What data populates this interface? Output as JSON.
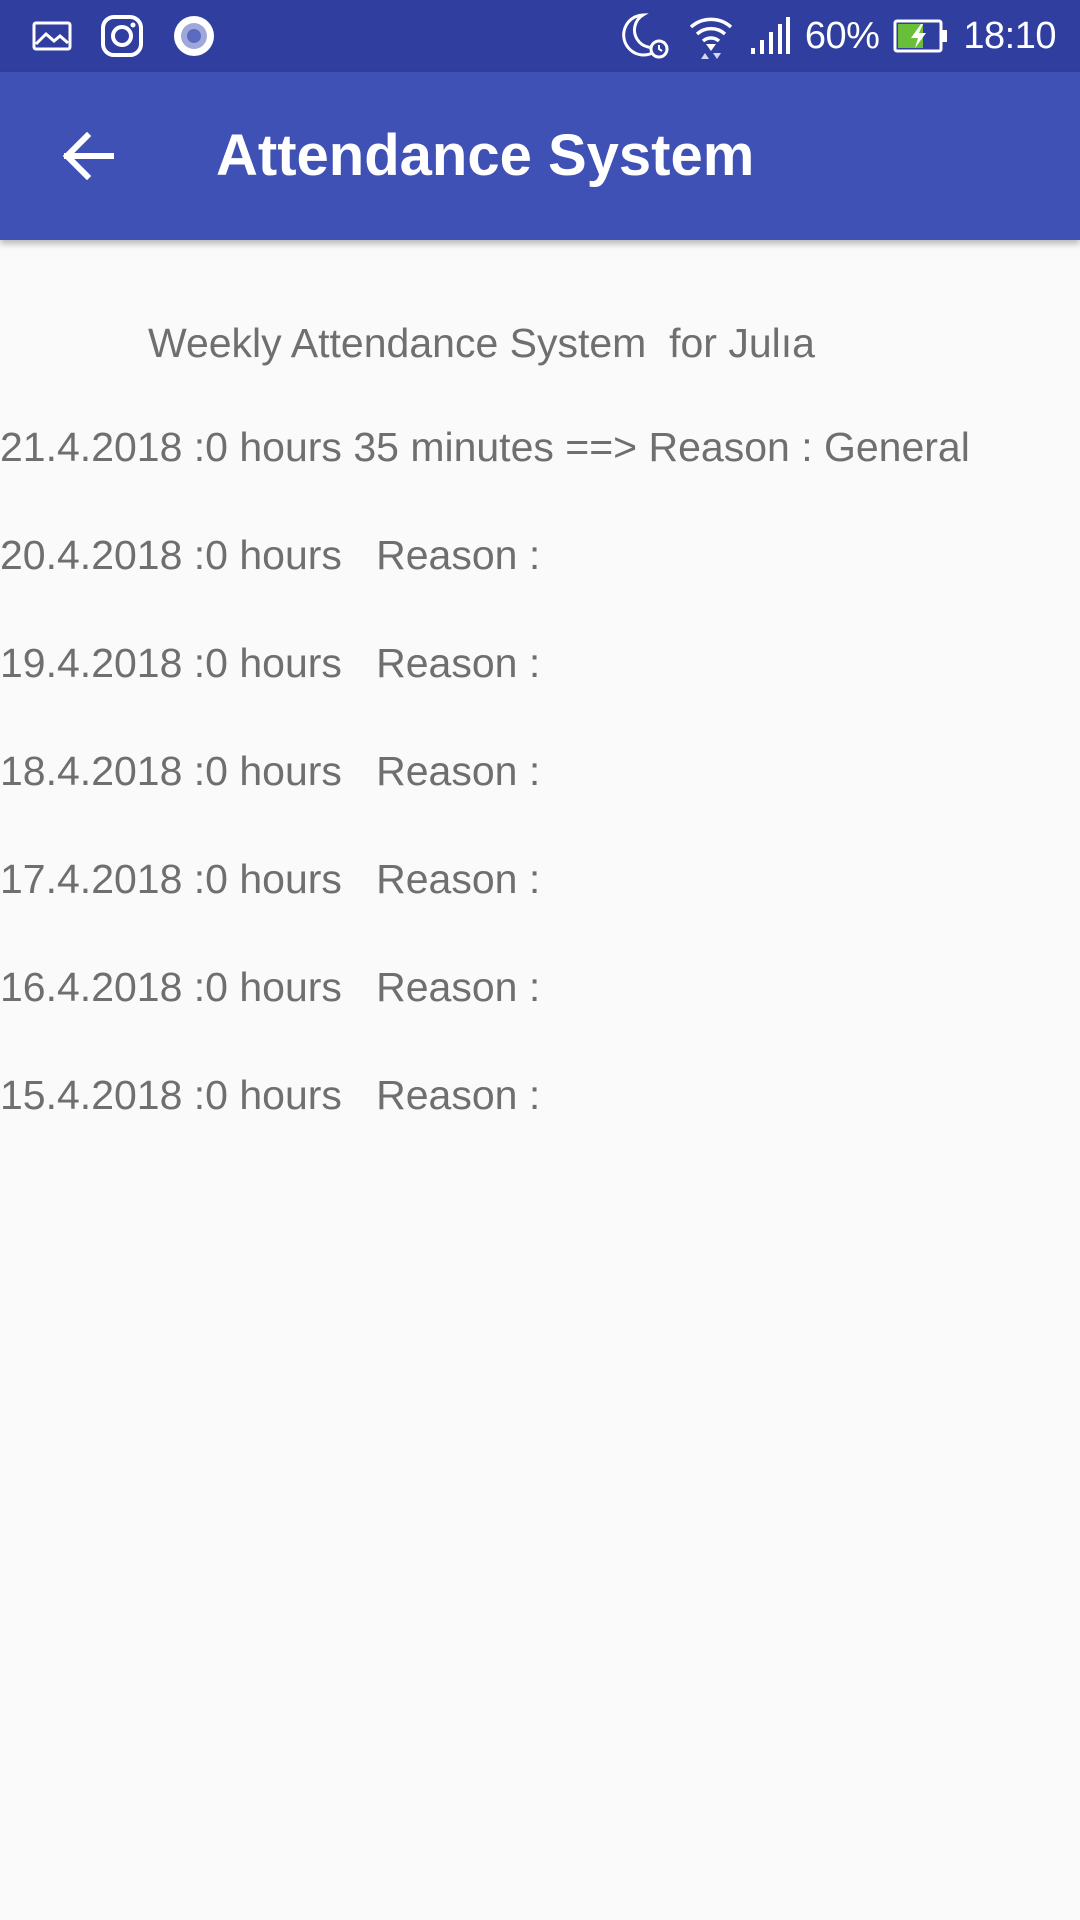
{
  "status_bar": {
    "battery_percent": "60%",
    "time": "18:10",
    "icons": [
      "gallery-icon",
      "instagram-icon",
      "circle-app-icon",
      "do-not-disturb-alarm-icon",
      "wifi-icon",
      "signal-icon",
      "battery-charging-icon"
    ]
  },
  "app_bar": {
    "title": "Attendance System",
    "back_icon": "arrow-back-icon"
  },
  "colors": {
    "status_bar": "#303f9f",
    "app_bar": "#3f51b5",
    "text": "#6f6f6f",
    "background": "#fafafa",
    "battery_fill": "#6abf3a"
  },
  "content": {
    "heading": "Weekly Attendance System  for Julıa",
    "entries": [
      "21.4.2018 :0 hours 35 minutes ==> Reason : General",
      "20.4.2018 :0 hours   Reason :",
      "19.4.2018 :0 hours   Reason :",
      "18.4.2018 :0 hours   Reason :",
      "17.4.2018 :0 hours   Reason :",
      "16.4.2018 :0 hours   Reason :",
      "15.4.2018 :0 hours   Reason :"
    ]
  }
}
